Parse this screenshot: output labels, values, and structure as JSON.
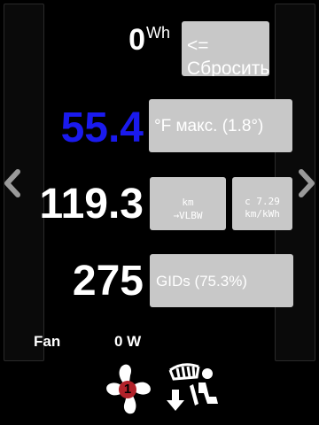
{
  "energy": {
    "value": "0",
    "unit": "Wh",
    "reset_label": "<= Сбросить"
  },
  "temperature": {
    "value": "55.4",
    "button_label": "°F макс. (1.8°)",
    "value_color": "#1a1aee"
  },
  "range": {
    "value": "119.3",
    "km_line1": "km",
    "km_line2": "→VLBW",
    "eff_line1": "c 7.29",
    "eff_line2": "km/kWh"
  },
  "gids": {
    "value": "275",
    "button_label": "GIDs (75.3%)"
  },
  "climate": {
    "fan_label": "Fan",
    "power_label": "0 W",
    "fan_speed": "1"
  },
  "icons": {
    "left": "chevron-left-icon",
    "right": "chevron-right-icon",
    "fan": "fan-icon",
    "vent": "defrost-vent-mode-icon"
  },
  "colors": {
    "button_bg": "#c8c8c8",
    "background": "#000000",
    "fan_badge": "#b2222a"
  }
}
